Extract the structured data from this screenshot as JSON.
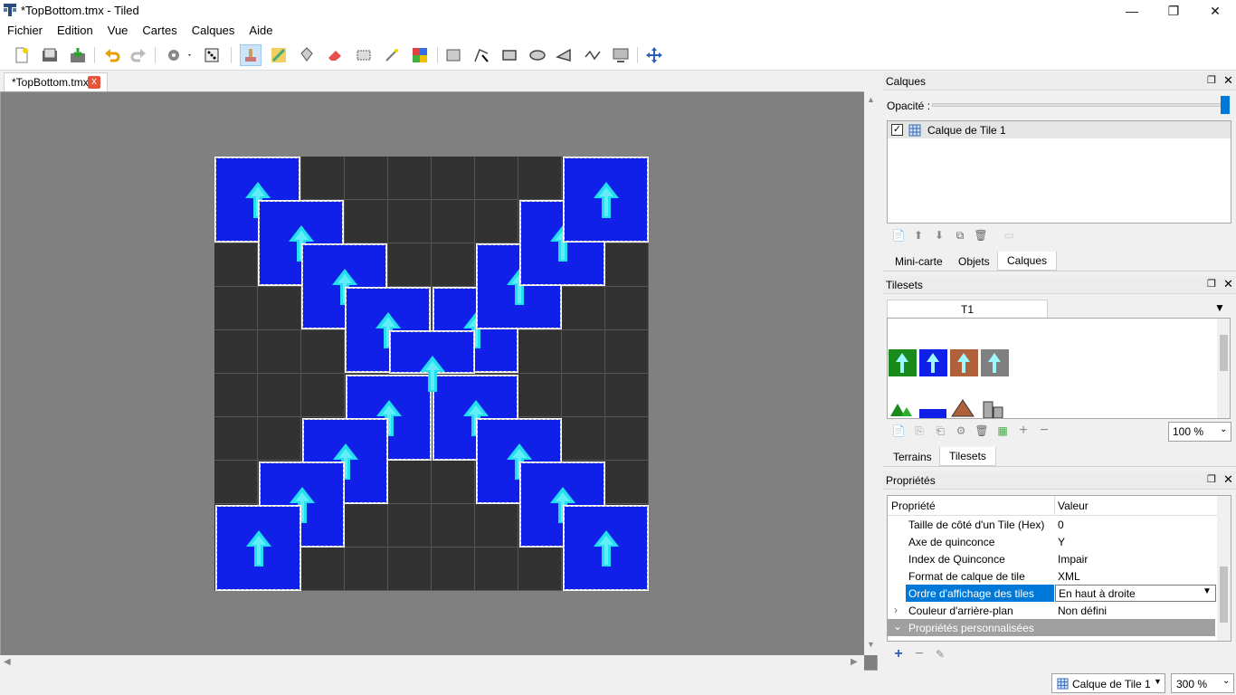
{
  "window": {
    "title": "*TopBottom.tmx - Tiled",
    "minimize": "—",
    "restore": "❐",
    "close": "✕"
  },
  "menubar": [
    "Fichier",
    "Edition",
    "Vue",
    "Cartes",
    "Calques",
    "Aide"
  ],
  "toolbar": {
    "icons": [
      "new-map-icon",
      "open-icon",
      "save-icon",
      "undo-icon",
      "redo-icon",
      "commands-icon",
      "random-mode-icon",
      "stamp-brush-icon",
      "terrain-brush-icon",
      "bucket-fill-icon",
      "eraser-icon",
      "rectangular-select-icon",
      "magic-wand-icon",
      "select-same-tile-icon",
      "select-objects-icon",
      "edit-polygons-icon",
      "insert-rectangle-icon",
      "insert-ellipse-icon",
      "insert-polygon-icon",
      "insert-polyline-icon",
      "insert-tile-icon",
      "move-icon"
    ],
    "active": "stamp-brush-icon"
  },
  "document_tab": {
    "label": "*TopBottom.tmx",
    "close": "x"
  },
  "map": {
    "background": "#808080",
    "tile_color": "#1020e8",
    "arrow_color": "#22e0f0",
    "tiles_grid": [
      [
        0,
        0
      ],
      [
        1,
        1
      ],
      [
        2,
        2
      ],
      [
        3,
        3
      ],
      [
        4,
        3
      ],
      [
        5,
        2
      ],
      [
        6,
        1
      ],
      [
        7,
        0
      ],
      [
        3,
        5
      ],
      [
        4,
        5
      ],
      [
        2,
        6
      ],
      [
        5,
        6
      ],
      [
        1,
        7
      ],
      [
        6,
        7
      ],
      [
        0,
        8
      ],
      [
        7,
        8
      ],
      [
        4,
        4
      ]
    ]
  },
  "layers_panel": {
    "title": "Calques",
    "opacity_label": "Opacité :",
    "opacity_value": 1.0,
    "layers": [
      {
        "name": "Calque de Tile 1",
        "visible": true
      }
    ],
    "tabs": [
      "Mini-carte",
      "Objets",
      "Calques"
    ],
    "active_tab": "Calques"
  },
  "tilesets_panel": {
    "title": "Tilesets",
    "tileset_tab": "T1",
    "tile_colors": [
      "#1a8a1a",
      "#1020e8",
      "#b0603a",
      "#808080"
    ],
    "zoom": "100 %",
    "tabs": [
      "Terrains",
      "Tilesets"
    ],
    "active_tab": "Tilesets"
  },
  "properties_panel": {
    "title": "Propriétés",
    "col_property": "Propriété",
    "col_value": "Valeur",
    "rows": [
      {
        "name": "Taille de côté d'un Tile (Hex)",
        "value": "0"
      },
      {
        "name": "Axe de quinconce",
        "value": "Y"
      },
      {
        "name": "Index de Quinconce",
        "value": "Impair"
      },
      {
        "name": "Format de calque de tile",
        "value": "XML"
      },
      {
        "name": "Ordre d'affichage des tiles",
        "value": "En haut à droite"
      },
      {
        "name": "Couleur d'arrière-plan",
        "value": "Non défini"
      }
    ],
    "selected_row": "Ordre d'affichage des tiles",
    "section": "Propriétés personnalisées"
  },
  "statusbar": {
    "layer": "Calque de Tile 1",
    "zoom": "300 %"
  }
}
